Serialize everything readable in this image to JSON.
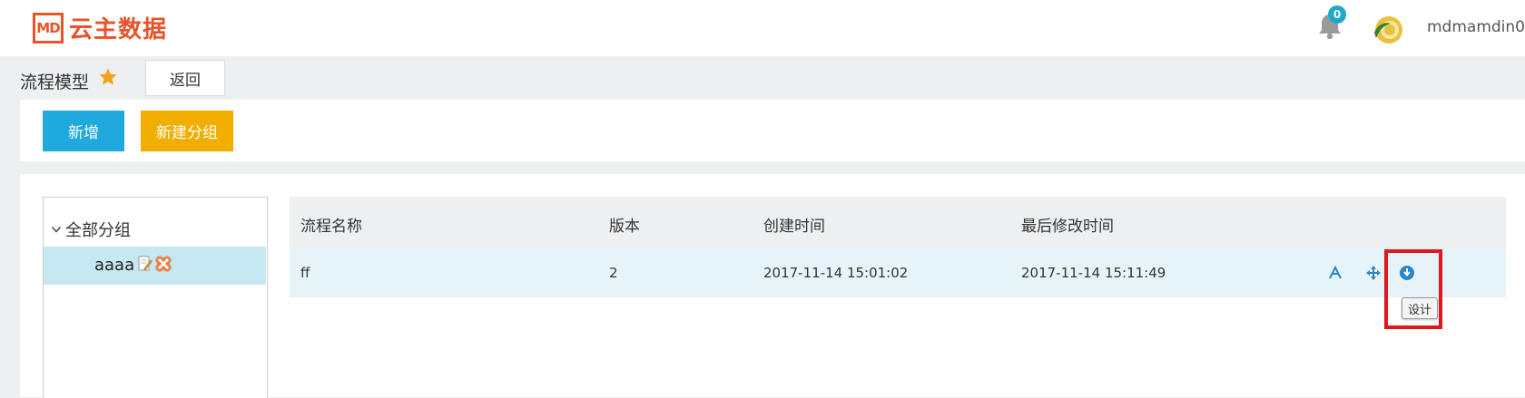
{
  "header": {
    "logo_mark": "MD",
    "logo_text": "云主数据",
    "notification_count": "0",
    "username": "mdmamdin0",
    "brand_color": "#e8532a",
    "badge_color": "#1fa8c9"
  },
  "breadcrumb": {
    "title": "流程模型",
    "back_label": "返回"
  },
  "toolbar": {
    "add_label": "新增",
    "add_group_label": "新建分组",
    "add_color": "#1fa9dc",
    "add_group_color": "#f2ae00"
  },
  "tree": {
    "root_label": "全部分组",
    "items": [
      {
        "label": "aaaa"
      }
    ]
  },
  "table": {
    "columns": [
      "流程名称",
      "版本",
      "创建时间",
      "最后修改时间"
    ],
    "rows": [
      {
        "name": "ff",
        "version": "2",
        "created": "2017-11-14 15:01:02",
        "modified": "2017-11-14 15:11:49"
      }
    ]
  },
  "tooltip": {
    "design_label": "设计"
  },
  "icons": [
    "bell-icon",
    "star-icon",
    "chevron-down-icon",
    "edit-icon",
    "delete-icon",
    "design-icon",
    "move-icon",
    "download-icon"
  ]
}
